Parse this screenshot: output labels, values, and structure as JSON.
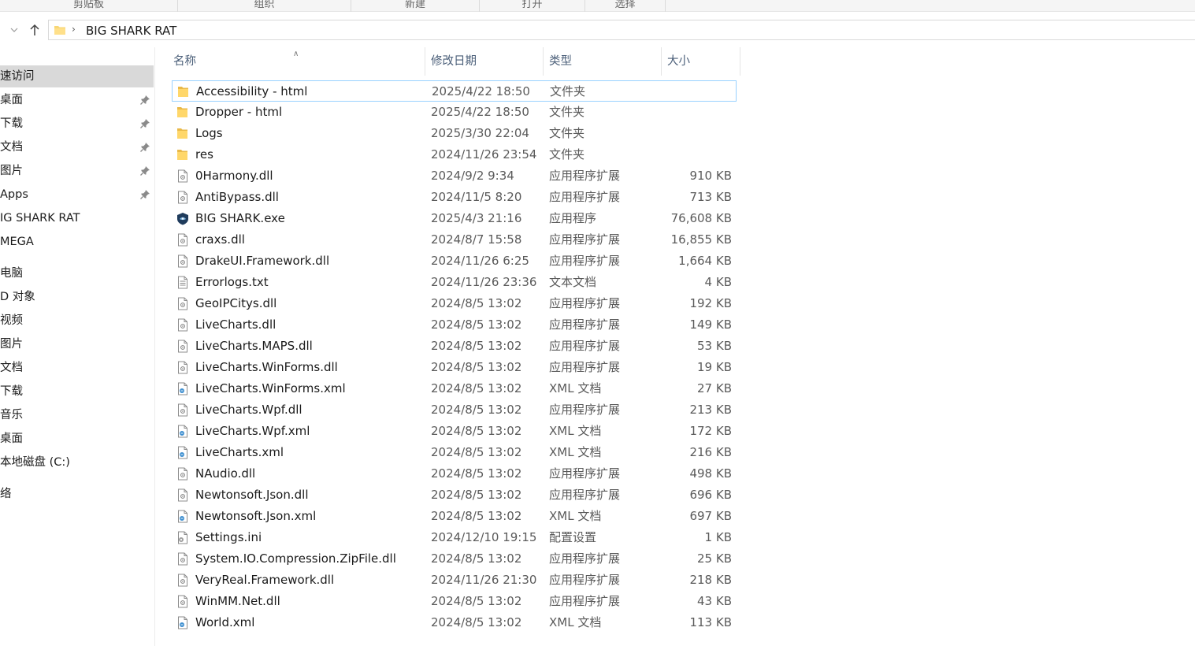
{
  "ribbon": {
    "groups": [
      "剪贴板",
      "组织",
      "新建",
      "打开",
      "选择"
    ]
  },
  "address": {
    "back_icon": "chevron-down-icon",
    "up_icon": "arrow-up-icon",
    "path_segment": "BIG SHARK RAT"
  },
  "sidebar": {
    "items": [
      {
        "label": "速访问",
        "pinned": false,
        "active": true
      },
      {
        "label": "桌面",
        "pinned": true
      },
      {
        "label": "下载",
        "pinned": true
      },
      {
        "label": "文档",
        "pinned": true
      },
      {
        "label": "图片",
        "pinned": true
      },
      {
        "label": "Apps",
        "pinned": true
      },
      {
        "label": "IG SHARK RAT",
        "pinned": false
      },
      {
        "label": "MEGA",
        "pinned": false
      },
      {
        "label": "电脑",
        "pinned": false
      },
      {
        "label": "D 对象",
        "pinned": false
      },
      {
        "label": "视频",
        "pinned": false
      },
      {
        "label": "图片",
        "pinned": false
      },
      {
        "label": "文档",
        "pinned": false
      },
      {
        "label": "下载",
        "pinned": false
      },
      {
        "label": "音乐",
        "pinned": false
      },
      {
        "label": "桌面",
        "pinned": false
      },
      {
        "label": "本地磁盘 (C:)",
        "pinned": false
      },
      {
        "label": "络",
        "pinned": false
      }
    ]
  },
  "columns": {
    "name": "名称",
    "date": "修改日期",
    "type": "类型",
    "size": "大小"
  },
  "files": [
    {
      "name": "Accessibility - html",
      "date": "2025/4/22 18:50",
      "type": "文件夹",
      "size": "",
      "icon": "folder-icon"
    },
    {
      "name": "Dropper -  html",
      "date": "2025/4/22 18:50",
      "type": "文件夹",
      "size": "",
      "icon": "folder-icon"
    },
    {
      "name": "Logs",
      "date": "2025/3/30 22:04",
      "type": "文件夹",
      "size": "",
      "icon": "folder-icon"
    },
    {
      "name": "res",
      "date": "2024/11/26 23:54",
      "type": "文件夹",
      "size": "",
      "icon": "folder-icon"
    },
    {
      "name": "0Harmony.dll",
      "date": "2024/9/2 9:34",
      "type": "应用程序扩展",
      "size": "910 KB",
      "icon": "dll-file-icon"
    },
    {
      "name": "AntiBypass.dll",
      "date": "2024/11/5 8:20",
      "type": "应用程序扩展",
      "size": "713 KB",
      "icon": "dll-file-icon"
    },
    {
      "name": "BIG SHARK.exe",
      "date": "2025/4/3 21:16",
      "type": "应用程序",
      "size": "76,608 KB",
      "icon": "app-exe-icon"
    },
    {
      "name": "craxs.dll",
      "date": "2024/8/7 15:58",
      "type": "应用程序扩展",
      "size": "16,855 KB",
      "icon": "dll-file-icon"
    },
    {
      "name": "DrakeUI.Framework.dll",
      "date": "2024/11/26 6:25",
      "type": "应用程序扩展",
      "size": "1,664 KB",
      "icon": "dll-file-icon"
    },
    {
      "name": "Errorlogs.txt",
      "date": "2024/11/26 23:36",
      "type": "文本文档",
      "size": "4 KB",
      "icon": "text-file-icon"
    },
    {
      "name": "GeoIPCitys.dll",
      "date": "2024/8/5 13:02",
      "type": "应用程序扩展",
      "size": "192 KB",
      "icon": "dll-file-icon"
    },
    {
      "name": "LiveCharts.dll",
      "date": "2024/8/5 13:02",
      "type": "应用程序扩展",
      "size": "149 KB",
      "icon": "dll-file-icon"
    },
    {
      "name": "LiveCharts.MAPS.dll",
      "date": "2024/8/5 13:02",
      "type": "应用程序扩展",
      "size": "53 KB",
      "icon": "dll-file-icon"
    },
    {
      "name": "LiveCharts.WinForms.dll",
      "date": "2024/8/5 13:02",
      "type": "应用程序扩展",
      "size": "19 KB",
      "icon": "dll-file-icon"
    },
    {
      "name": "LiveCharts.WinForms.xml",
      "date": "2024/8/5 13:02",
      "type": "XML 文档",
      "size": "27 KB",
      "icon": "xml-file-icon"
    },
    {
      "name": "LiveCharts.Wpf.dll",
      "date": "2024/8/5 13:02",
      "type": "应用程序扩展",
      "size": "213 KB",
      "icon": "dll-file-icon"
    },
    {
      "name": "LiveCharts.Wpf.xml",
      "date": "2024/8/5 13:02",
      "type": "XML 文档",
      "size": "172 KB",
      "icon": "xml-file-icon"
    },
    {
      "name": "LiveCharts.xml",
      "date": "2024/8/5 13:02",
      "type": "XML 文档",
      "size": "216 KB",
      "icon": "xml-file-icon"
    },
    {
      "name": "NAudio.dll",
      "date": "2024/8/5 13:02",
      "type": "应用程序扩展",
      "size": "498 KB",
      "icon": "dll-file-icon"
    },
    {
      "name": "Newtonsoft.Json.dll",
      "date": "2024/8/5 13:02",
      "type": "应用程序扩展",
      "size": "696 KB",
      "icon": "dll-file-icon"
    },
    {
      "name": "Newtonsoft.Json.xml",
      "date": "2024/8/5 13:02",
      "type": "XML 文档",
      "size": "697 KB",
      "icon": "xml-file-icon"
    },
    {
      "name": "Settings.ini",
      "date": "2024/12/10 19:15",
      "type": "配置设置",
      "size": "1 KB",
      "icon": "settings-file-icon"
    },
    {
      "name": "System.IO.Compression.ZipFile.dll",
      "date": "2024/8/5 13:02",
      "type": "应用程序扩展",
      "size": "25 KB",
      "icon": "dll-file-icon"
    },
    {
      "name": "VeryReal.Framework.dll",
      "date": "2024/11/26 21:30",
      "type": "应用程序扩展",
      "size": "218 KB",
      "icon": "dll-file-icon"
    },
    {
      "name": "WinMM.Net.dll",
      "date": "2024/8/5 13:02",
      "type": "应用程序扩展",
      "size": "43 KB",
      "icon": "dll-file-icon"
    },
    {
      "name": "World.xml",
      "date": "2024/8/5 13:02",
      "type": "XML 文档",
      "size": "113 KB",
      "icon": "xml-file-icon"
    }
  ],
  "selected_index": 0
}
